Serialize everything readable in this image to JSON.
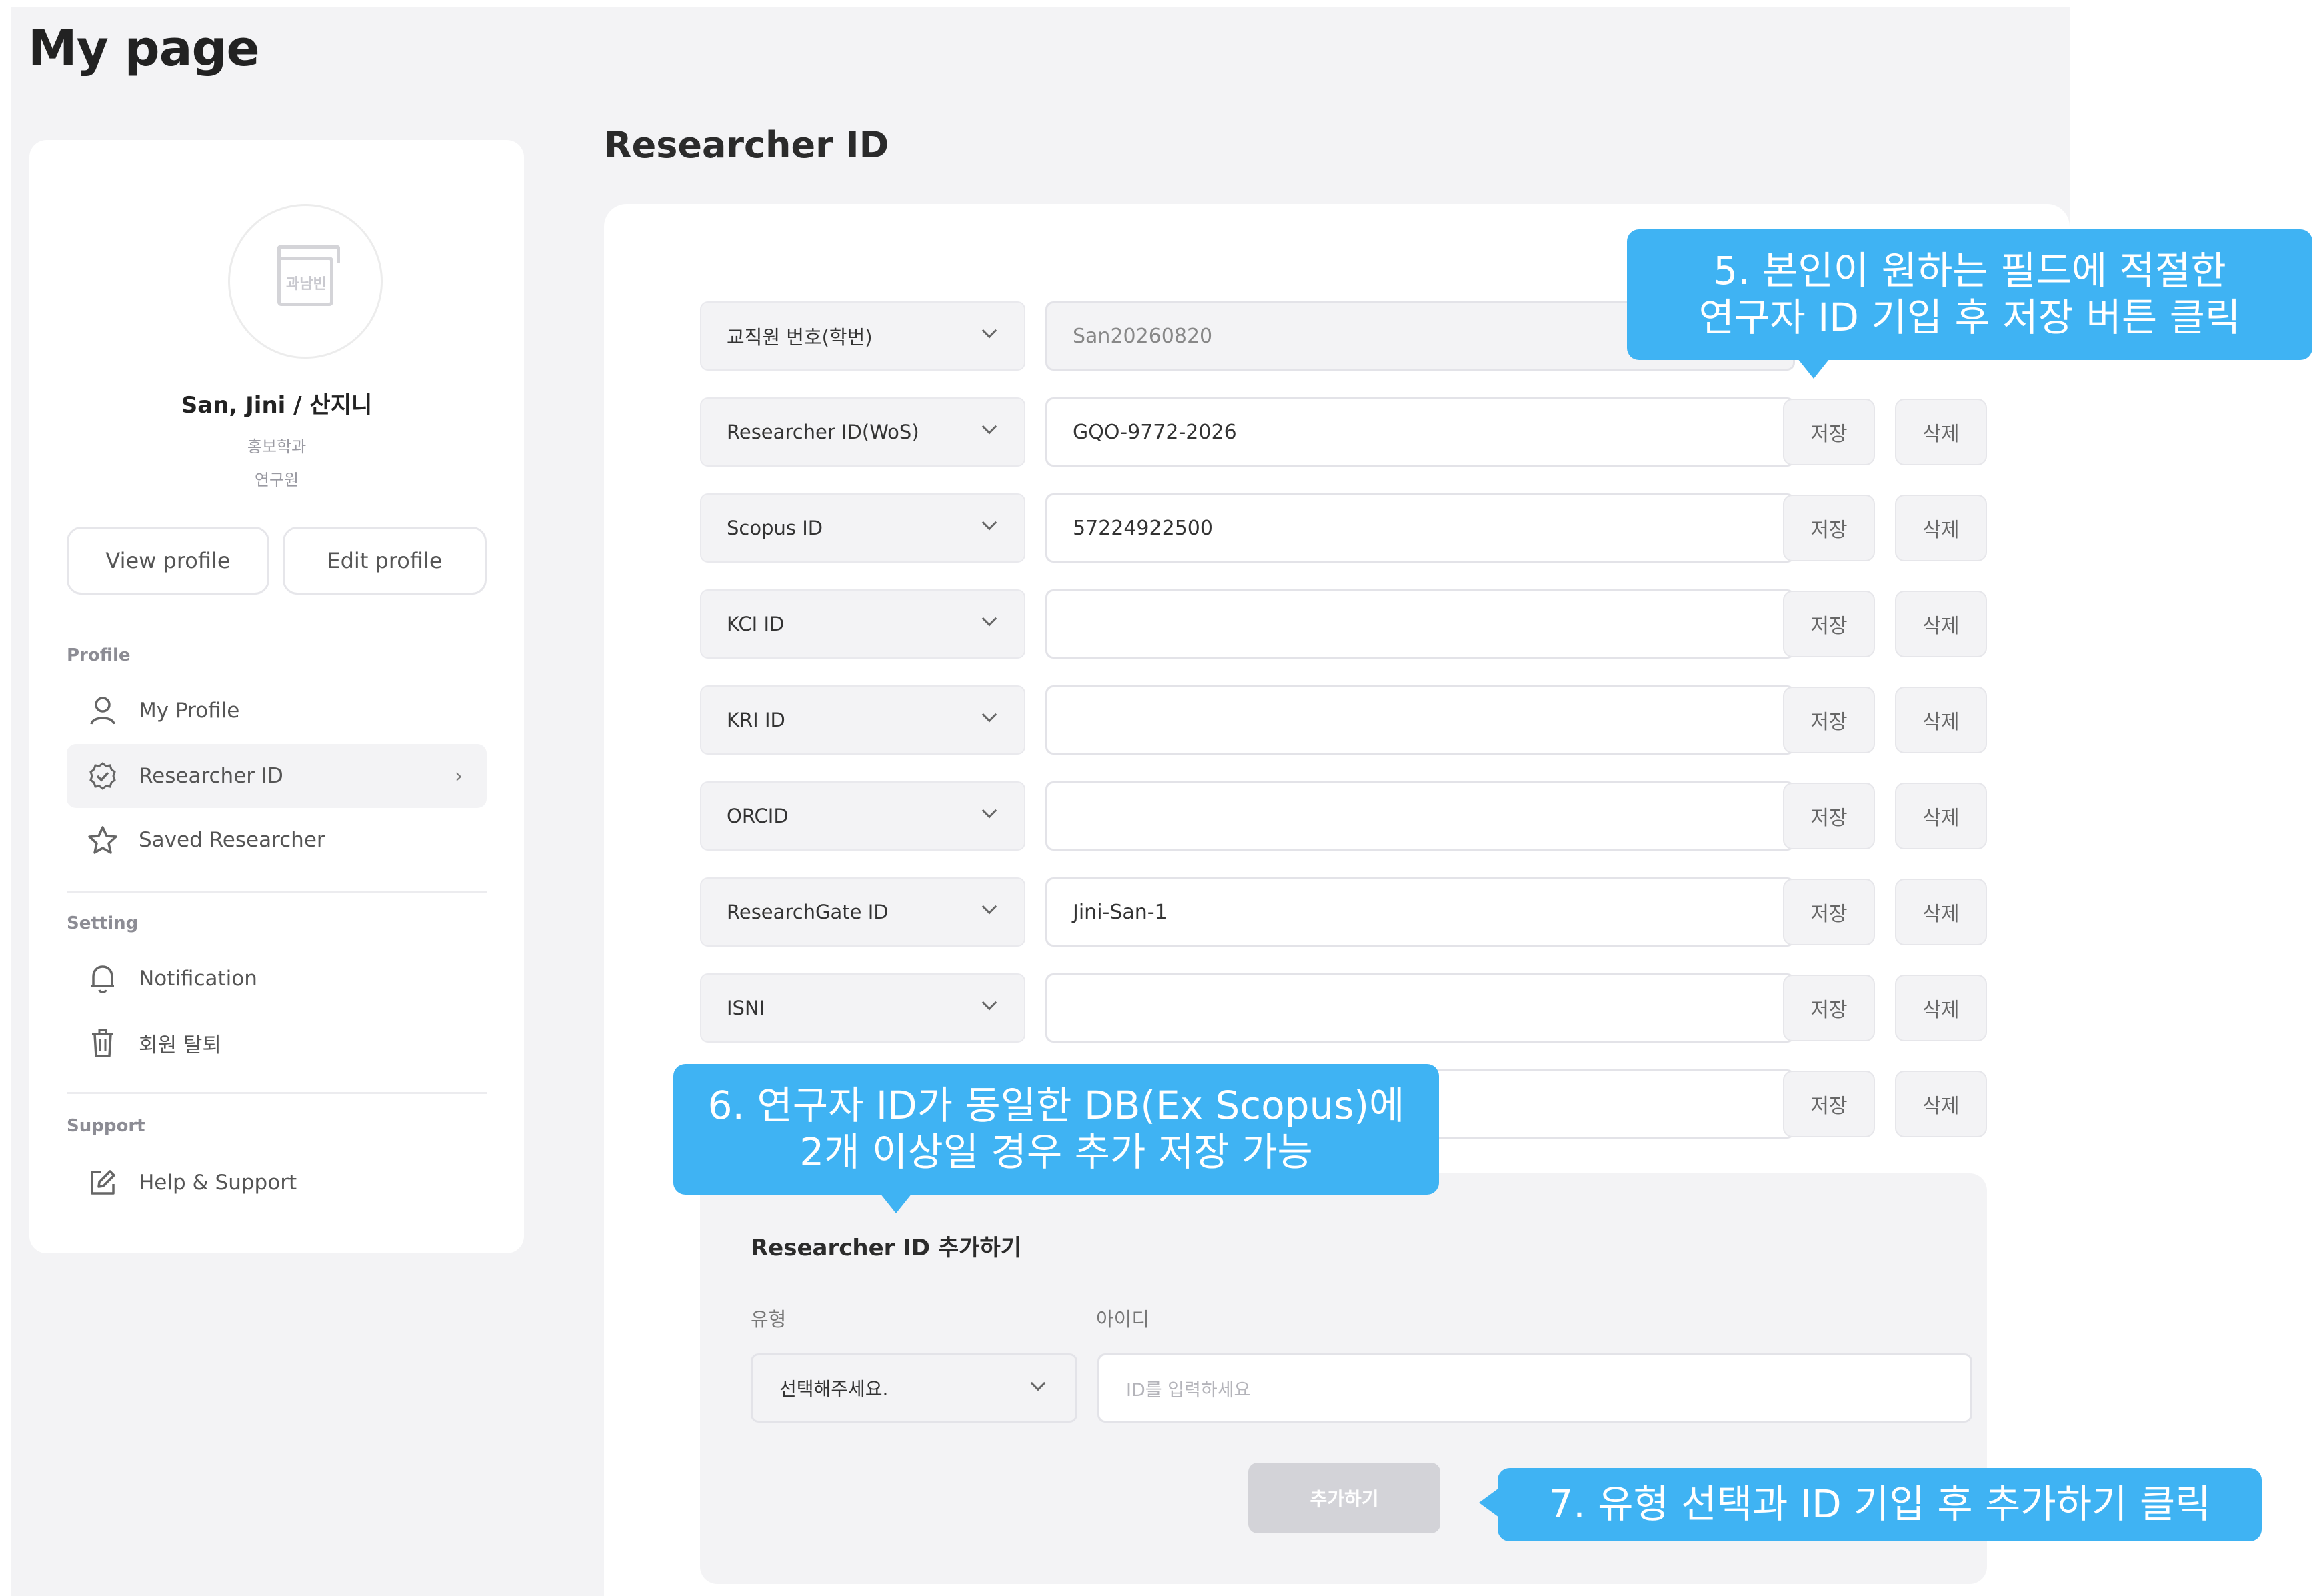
{
  "page": {
    "title": "My page"
  },
  "sidebar": {
    "user": {
      "name": "San, Jini / 산지니",
      "department": "홍보학과",
      "role": "연구원",
      "avatar_icon": "university-logo-icon",
      "avatar_text": "과남빈"
    },
    "buttons": {
      "view_profile": "View profile",
      "edit_profile": "Edit profile"
    },
    "sections": {
      "profile": {
        "label": "Profile",
        "items": [
          {
            "label": "My Profile",
            "icon": "user-icon"
          },
          {
            "label": "Researcher ID",
            "icon": "badge-check-icon",
            "active": true,
            "chevron": "›"
          },
          {
            "label": "Saved Researcher",
            "icon": "star-icon"
          }
        ]
      },
      "setting": {
        "label": "Setting",
        "items": [
          {
            "label": "Notification",
            "icon": "bell-icon"
          },
          {
            "label": "회원 탈퇴",
            "icon": "trash-icon"
          }
        ]
      },
      "support": {
        "label": "Support",
        "items": [
          {
            "label": "Help & Support",
            "icon": "edit-icon"
          }
        ]
      }
    }
  },
  "main": {
    "title": "Researcher ID",
    "save_label": "저장",
    "delete_label": "삭제",
    "rows": [
      {
        "type": "교직원 번호(학번)",
        "value": "San20260820",
        "readonly": true
      },
      {
        "type": "Researcher ID(WoS)",
        "value": "GQO-9772-2026"
      },
      {
        "type": "Scopus ID",
        "value": "57224922500"
      },
      {
        "type": "KCI ID",
        "value": ""
      },
      {
        "type": "KRI ID",
        "value": ""
      },
      {
        "type": "ORCID",
        "value": ""
      },
      {
        "type": "ResearchGate ID",
        "value": "Jini-San-1"
      },
      {
        "type": "ISNI",
        "value": ""
      },
      {
        "type": "",
        "value": ""
      }
    ],
    "add_section": {
      "title": "Researcher ID 추가하기",
      "type_label": "유형",
      "id_label": "아이디",
      "type_value": "선택해주세요.",
      "id_placeholder": "ID를 입력하세요",
      "add_button": "추가하기"
    }
  },
  "callouts": {
    "c5": {
      "line1": "5. 본인이 원하는 필드에 적절한",
      "line2": "연구자 ID 기입 후 저장 버튼 클릭"
    },
    "c6": {
      "line1": "6. 연구자 ID가 동일한 DB(Ex Scopus)에",
      "line2": "2개 이상일 경우 추가 저장 가능"
    },
    "c7": {
      "line1": "7. 유형 선택과 ID 기입 후 추가하기 클릭"
    }
  },
  "colors": {
    "callout": "#3fb3f3",
    "background": "#f3f3f5",
    "card": "#ffffff"
  }
}
